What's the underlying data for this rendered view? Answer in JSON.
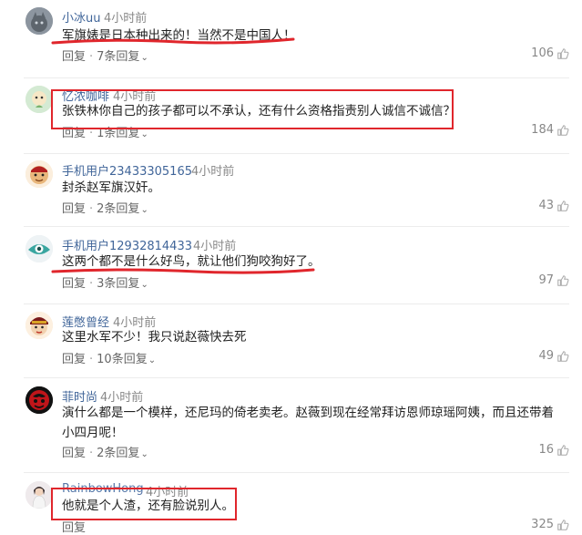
{
  "accent_color": "#e0262c",
  "reply_label": "回复",
  "comments": [
    {
      "avatar": "cat-avatar",
      "username": "小冰uu",
      "time": "4小时前",
      "text": "军旗婊是日本种出来的！当然不是中国人！",
      "replies_text": "7条回复",
      "likes": "106"
    },
    {
      "avatar": "cartoon-avatar",
      "username": "忆浓咖啡",
      "time": "4小时前",
      "text": "张铁林你自己的孩子都可以不承认，还有什么资格指责别人诚信不诚信？",
      "replies_text": "1条回复",
      "likes": "184"
    },
    {
      "avatar": "face-avatar",
      "username": "手机用户23433305165",
      "time": "4小时前",
      "text": "封杀赵军旗汉奸。",
      "replies_text": "2条回复",
      "likes": "43"
    },
    {
      "avatar": "eye-avatar",
      "username": "手机用户12932814433",
      "time": "4小时前",
      "text": "这两个都不是什么好鸟，就让他们狗咬狗好了。",
      "replies_text": "3条回复",
      "likes": "97"
    },
    {
      "avatar": "opera-mask-avatar",
      "username": "莲憋曾经",
      "time": "4小时前",
      "text": "这里水军不少！我只说赵薇快去死",
      "replies_text": "10条回复",
      "likes": "49"
    },
    {
      "avatar": "red-mask-avatar",
      "username": "菲时尚",
      "time": "4小时前",
      "text": "演什么都是一个模样，还尼玛的倚老卖老。赵薇到现在经常拜访恩师琼瑶阿姨，而且还带着小四月呢！",
      "replies_text": "2条回复",
      "likes": "16"
    },
    {
      "avatar": "girl-avatar",
      "username": "RainbowHong",
      "time": "4小时前",
      "text": "他就是个人渣，还有脸说别人。",
      "replies_text": "",
      "likes": "325"
    }
  ]
}
